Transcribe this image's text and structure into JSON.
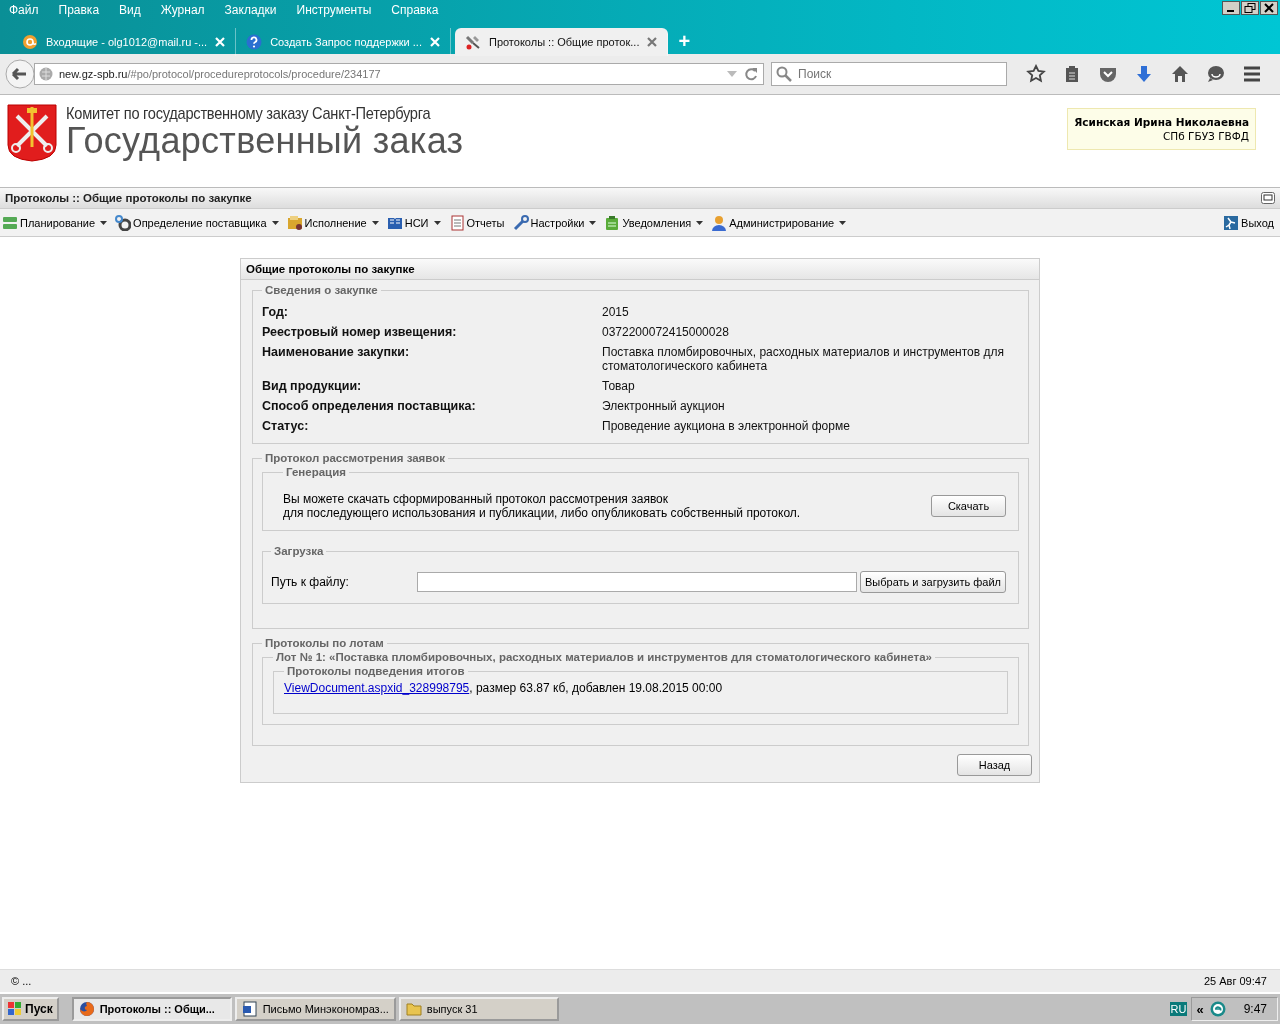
{
  "browser": {
    "menu": [
      "Файл",
      "Правка",
      "Вид",
      "Журнал",
      "Закладки",
      "Инструменты",
      "Справка"
    ],
    "tabs": [
      {
        "title": "Входящие - olg1012@mail.ru -...",
        "kind": "mail",
        "selected": false
      },
      {
        "title": "Создать Запрос поддержки ...",
        "kind": "help",
        "selected": false
      },
      {
        "title": "Протоколы :: Общие проток...",
        "kind": "tool",
        "selected": true
      }
    ],
    "new_tab": "+",
    "address_host": "new.gz-spb.ru",
    "address_path": "/#po/protocol/procedureprotocols/procedure/234177",
    "search": {
      "placeholder": "Поиск"
    }
  },
  "header": {
    "subtitle": "Комитет по государственному заказу Санкт-Петербурга",
    "title": "Государственный заказ",
    "user": {
      "name": "Ясинская Ирина Николаевна",
      "org": "СПб ГБУЗ ГВФД"
    }
  },
  "page_title": "Протоколы :: Общие протоколы по закупке",
  "toolbar": [
    {
      "label": "Планирование",
      "dropdown": true
    },
    {
      "label": "Определение поставщика",
      "dropdown": true
    },
    {
      "label": "Исполнение",
      "dropdown": true
    },
    {
      "label": "НСИ",
      "dropdown": true
    },
    {
      "label": "Отчеты",
      "dropdown": false
    },
    {
      "label": "Настройки",
      "dropdown": true
    },
    {
      "label": "Уведомления",
      "dropdown": true
    },
    {
      "label": "Администрирование",
      "dropdown": true
    }
  ],
  "logout": "Выход",
  "panel": {
    "title": "Общие протоколы по закупке",
    "info": {
      "legend": "Сведения о закупке",
      "fields": [
        {
          "label": "Год:",
          "value": "2015"
        },
        {
          "label": "Реестровый номер извещения:",
          "value": "0372200072415000028"
        },
        {
          "label": "Наименование закупки:",
          "value": "Поставка пломбировочных, расходных материалов и инструментов для стоматологического кабинета"
        },
        {
          "label": "Вид продукции:",
          "value": "Товар"
        },
        {
          "label": "Способ определения поставщика:",
          "value": "Электронный аукцион"
        },
        {
          "label": "Статус:",
          "value": "Проведение аукциона в электронной форме"
        }
      ]
    },
    "review": {
      "legend": "Протокол рассмотрения заявок",
      "generation": {
        "legend": "Генерация",
        "text": [
          "Вы можете скачать сформированный протокол рассмотрения заявок",
          "для последующего использования и публикации, либо опубликовать собственный протокол."
        ],
        "button": "Скачать"
      },
      "upload": {
        "legend": "Загрузка",
        "label": "Путь к файлу:",
        "button": "Выбрать и загрузить файл"
      }
    },
    "lots": {
      "legend": "Протоколы по лотам",
      "lot": {
        "legend": "Лот № 1: «Поставка пломбировочных, расходных материалов и инструментов для стоматологического кабинета»",
        "results": {
          "legend": "Протоколы подведения итогов",
          "link": "ViewDocument.aspxid_328998795",
          "text": ", размер 63.87 кб, добавлен 19.08.2015 00:00"
        }
      }
    },
    "back_button": "Назад"
  },
  "status_bar": {
    "left": "© ...",
    "right": "25 Авг 09:47"
  },
  "taskbar": {
    "start": "Пуск",
    "tasks": [
      {
        "label": "Протоколы :: Общи...",
        "kind": "firefox",
        "selected": true
      },
      {
        "label": "Письмо Минэкономраз...",
        "kind": "word",
        "selected": false
      },
      {
        "label": "выпуск 31",
        "kind": "folder",
        "selected": false
      }
    ],
    "lang": "RU",
    "tray_expand": "«",
    "clock": "9:47"
  }
}
